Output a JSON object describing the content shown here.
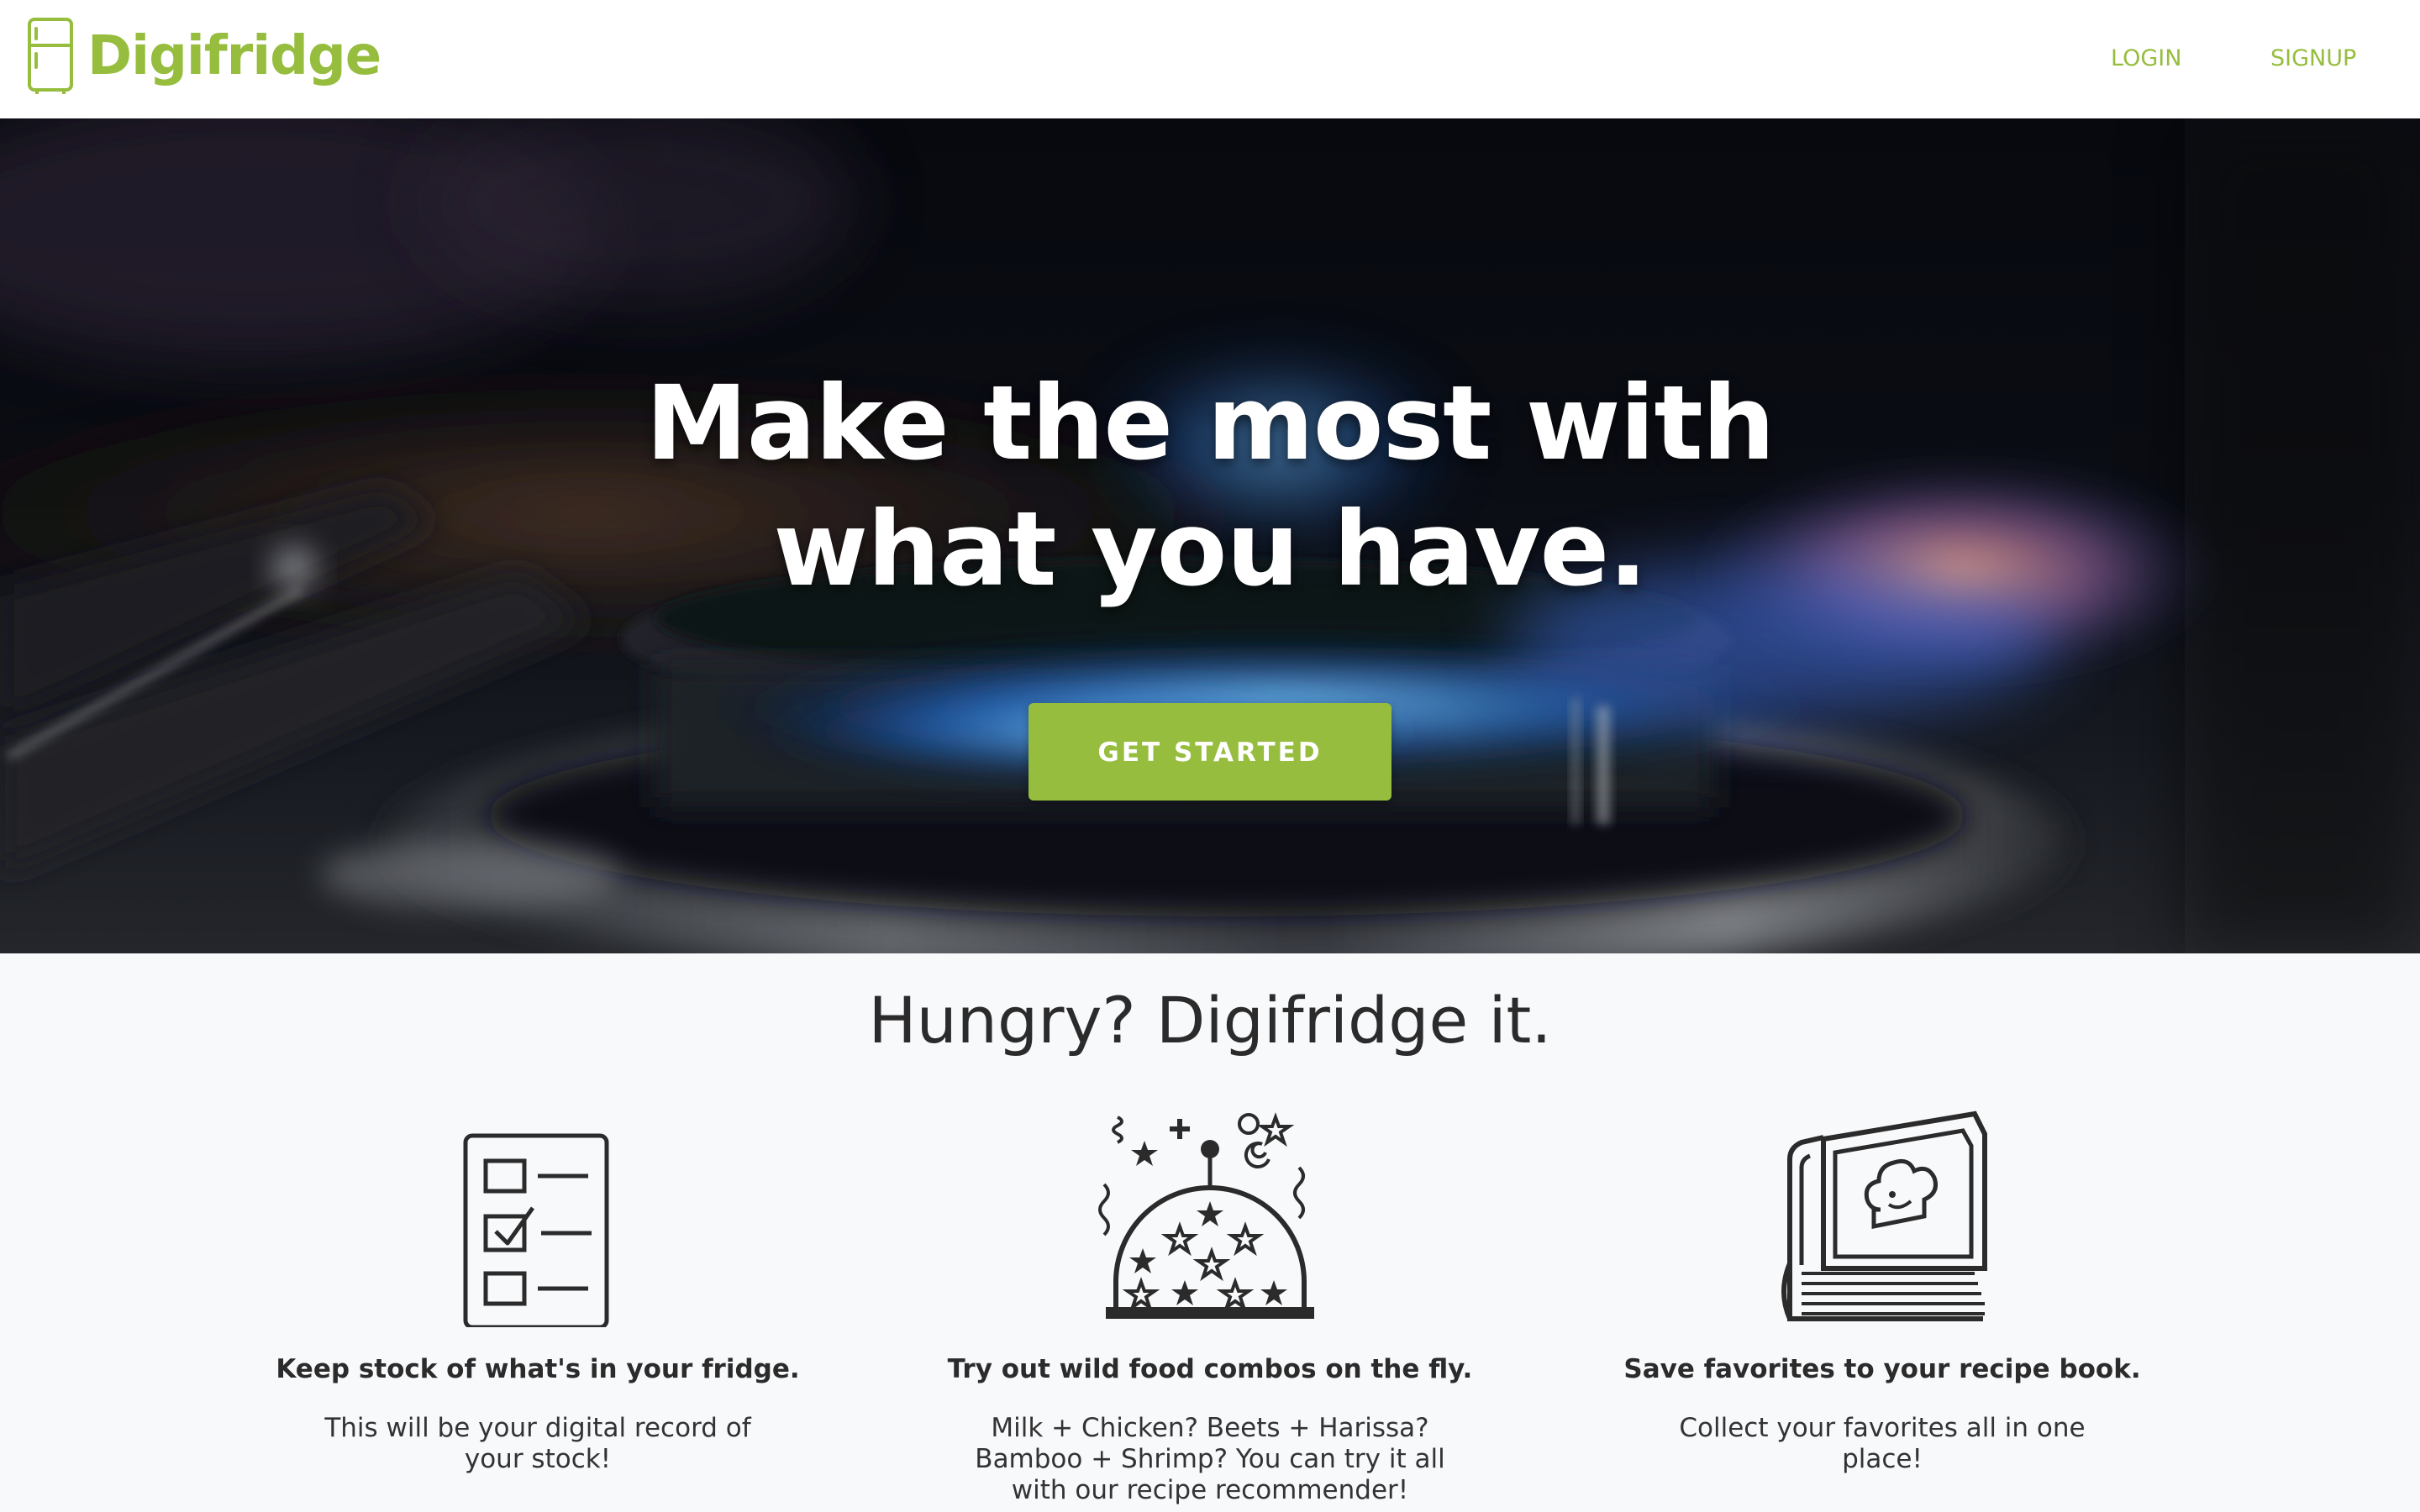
{
  "nav": {
    "brand": "Digifridge",
    "brand_icon": "fridge-icon",
    "login": "LOGIN",
    "signup": "SIGNUP"
  },
  "hero": {
    "title_line1": "Make the most with",
    "title_line2": "what you have.",
    "cta": "GET STARTED",
    "background": "gas-stove-flame-photo"
  },
  "features": {
    "tagline": "Hungry? Digifridge it.",
    "items": [
      {
        "icon": "checklist-icon",
        "title": "Keep stock of what's in your fridge.",
        "text": "This will be your digital record of your stock!"
      },
      {
        "icon": "magic-cloche-icon",
        "title": "Try out wild food combos on the fly.",
        "text": "Milk + Chicken? Beets + Harissa? Bamboo + Shrimp? You can try it all with our recipe recommender!"
      },
      {
        "icon": "recipe-book-icon",
        "title": "Save favorites to your recipe book.",
        "text": "Collect your favorites all in one place!"
      }
    ]
  },
  "colors": {
    "brand_green": "#96bd3e",
    "dark_text": "#2b2b2b",
    "page_bg": "#f8f9fb"
  }
}
